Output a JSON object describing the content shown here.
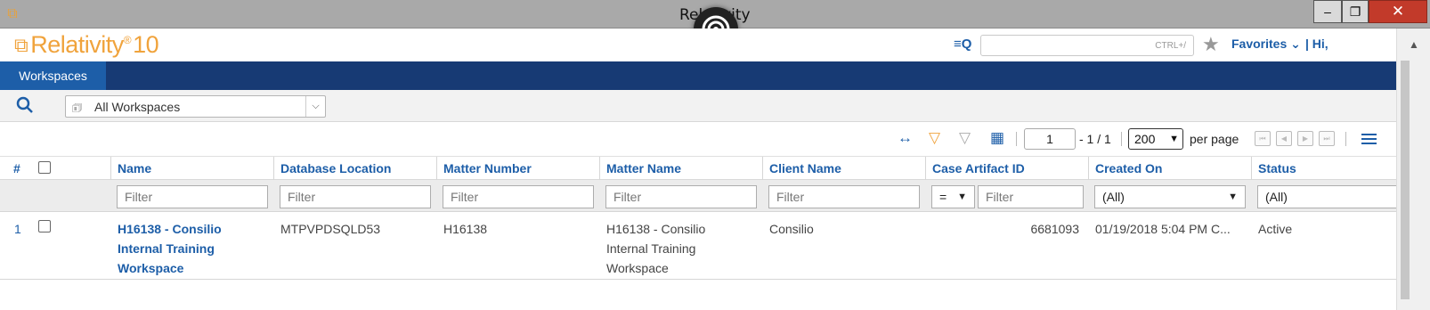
{
  "window": {
    "title": "Relativity",
    "buttons": {
      "minimize": "‒",
      "maximize": "❐",
      "close": "✕"
    }
  },
  "header": {
    "logo_text": "Relativity",
    "logo_reg": "®",
    "logo_version": "10",
    "search_shortcut": "CTRL+/",
    "favorites_label": "Favorites ⌄",
    "greeting": "| Hi,"
  },
  "tabs": [
    {
      "label": "Workspaces"
    }
  ],
  "view": {
    "selected": "All Workspaces"
  },
  "toolbar": {
    "page_input": "1",
    "page_range": "- 1 / 1",
    "per_page_value": "200",
    "per_page_label": "per page"
  },
  "grid": {
    "columns": [
      {
        "label": "#"
      },
      {
        "label": "Name"
      },
      {
        "label": "Database Location"
      },
      {
        "label": "Matter Number"
      },
      {
        "label": "Matter Name"
      },
      {
        "label": "Client Name"
      },
      {
        "label": "Case Artifact ID"
      },
      {
        "label": "Created On"
      },
      {
        "label": "Status"
      }
    ],
    "filters": {
      "placeholder": "Filter",
      "artifact_operator": "=",
      "created_on": "(All)",
      "status": "(All)"
    },
    "rows": [
      {
        "index": "1",
        "name_lines": [
          "H16138 - Consilio",
          "Internal Training",
          "Workspace"
        ],
        "database_location": "MTPVPDSQLD53",
        "matter_number": "H16138",
        "matter_name_lines": [
          "H16138 - Consilio",
          "Internal Training",
          "Workspace"
        ],
        "client_name": "Consilio",
        "case_artifact_id": "6681093",
        "created_on": "01/19/2018 5:04 PM C...",
        "status": "Active"
      }
    ]
  },
  "colors": {
    "brand_orange": "#f0a33c",
    "nav_blue": "#173a74",
    "tab_active_blue": "#1d5ea8",
    "link_blue": "#1d5ea8"
  }
}
